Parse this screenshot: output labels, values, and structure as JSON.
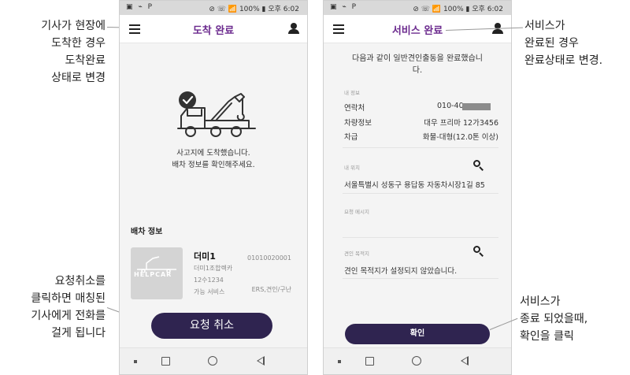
{
  "annotations": {
    "arrive": [
      "기사가 현장에",
      "도착한 경우",
      "도착완료",
      "상태로 변경"
    ],
    "cancel": [
      "요청취소를",
      "클릭하면 매칭된",
      "기사에게 전화를",
      "걸게 됩니다"
    ],
    "service_done": [
      "서비스가",
      "완료된 경우",
      "완료상태로 변경."
    ],
    "confirm": [
      "서비스가",
      "종료 되었을때,",
      "확인을 클릭"
    ]
  },
  "statusbar": {
    "left_icons": "▣ ⌁ P",
    "right_text": "⊘ ☏ 📶 100% ▮ 오후 6:02"
  },
  "left_screen": {
    "title": "도착 완료",
    "message_line1": "사고지에 도착했습니다.",
    "message_line2": "배차 정보를 확인해주세요.",
    "section_label": "배차 정보",
    "thumb_logo": "HELPCAR",
    "driver_name": "더미1",
    "company": "더미1조합렉카",
    "plate": "12수1234",
    "service_label": "가능 서비스",
    "phone": "01010020001",
    "services": "ERS,견인/구난",
    "cancel_button": "요청 취소"
  },
  "right_screen": {
    "title": "서비스 완료",
    "message_line1": "다음과 같이 일반견인출동을 완료했습니",
    "message_line2": "다.",
    "my_info_label": "내 정보",
    "contact_label": "연락처",
    "contact_value": "010-40",
    "vehicle_label": "차량정보",
    "vehicle_value": "대우 프리마 12가3456",
    "type_label": "차급",
    "type_value": "화물-대형(12.0톤 이상)",
    "location_label": "내 위치",
    "location_value": "서울특별시 성동구 용답동 자동차시장1길 85",
    "request_label": "요청 메시지",
    "destination_label": "견인 목적지",
    "destination_value": "견인 목적지가 설정되지 않았습니다.",
    "confirm_button": "확인"
  },
  "colors": {
    "title_purple": "#6b2a8e",
    "button_navy": "#2f2450"
  }
}
